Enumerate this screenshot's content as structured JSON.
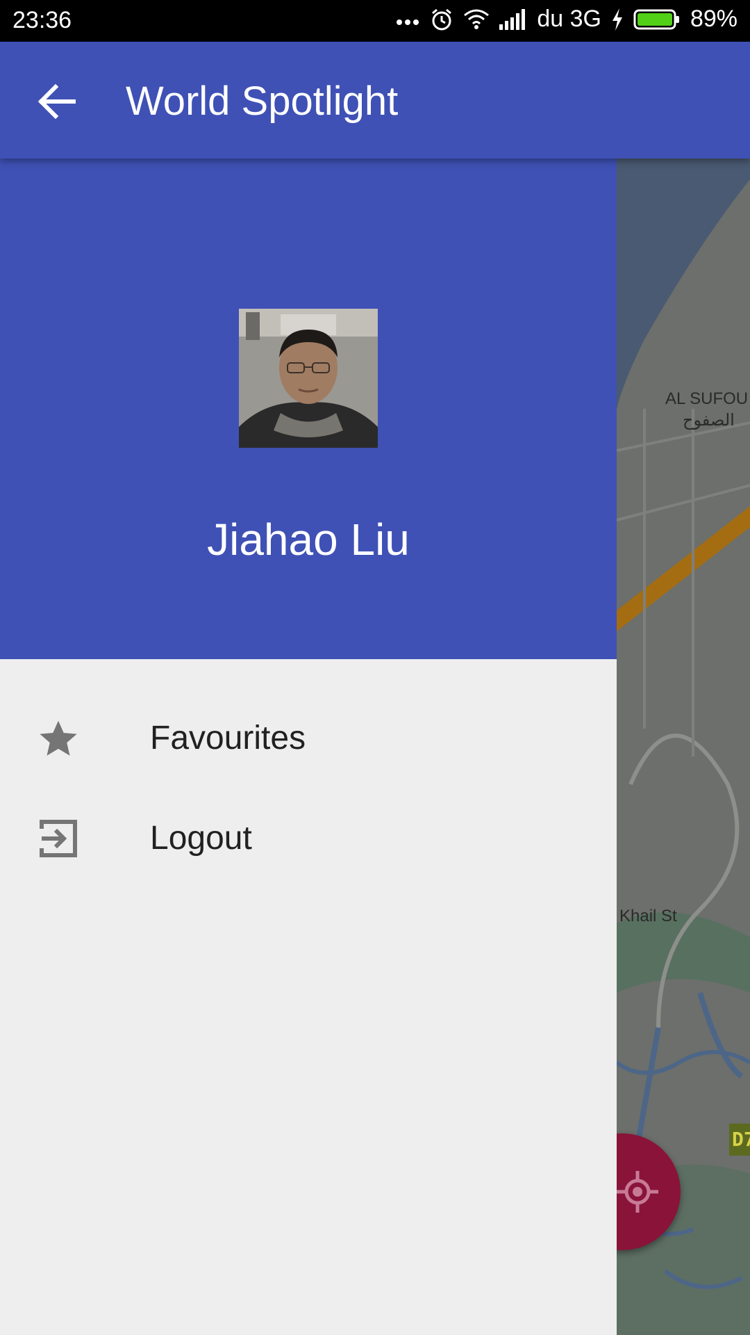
{
  "status_bar": {
    "time": "23:36",
    "carrier": "du 3G",
    "battery": "89%",
    "icons": [
      "more-dots-icon",
      "alarm-icon",
      "wifi-icon",
      "signal-icon",
      "charging-icon",
      "battery-icon"
    ]
  },
  "app_bar": {
    "title": "World Spotlight",
    "back_icon": "arrow-back-icon"
  },
  "drawer": {
    "user_name": "Jiahao Liu",
    "items": [
      {
        "label": "Favourites",
        "icon": "star-icon"
      },
      {
        "label": "Logout",
        "icon": "logout-icon"
      }
    ]
  },
  "map": {
    "labels": [
      "AL SUFOU",
      "الصفوح",
      "Khail St"
    ],
    "highway_badge": "D7",
    "fab_icon": "my-location-icon"
  },
  "colors": {
    "primary": "#3f51b5",
    "drawer_bg": "#eeeeee",
    "fab": "#8a1339"
  }
}
